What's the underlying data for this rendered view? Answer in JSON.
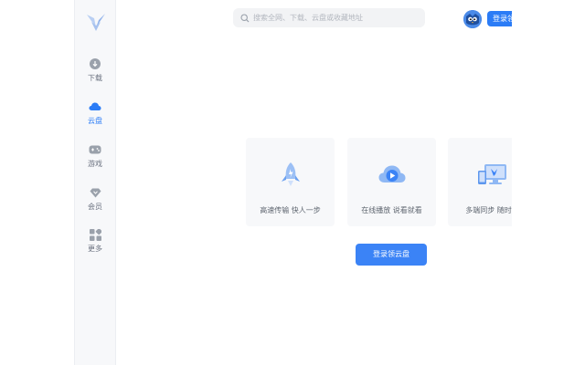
{
  "sidebar": {
    "items": [
      {
        "label": "下载",
        "icon": "download-icon"
      },
      {
        "label": "云盘",
        "icon": "cloud-icon"
      },
      {
        "label": "游戏",
        "icon": "gamepad-icon"
      },
      {
        "label": "会员",
        "icon": "diamond-icon"
      },
      {
        "label": "更多",
        "icon": "grid-icon"
      }
    ],
    "active_index": 1
  },
  "header": {
    "search_placeholder": "搜索全网、下载、云盘或收藏地址",
    "login_label": "登录领"
  },
  "main": {
    "features": [
      {
        "caption": "高速传输 快人一步",
        "icon": "rocket-icon"
      },
      {
        "caption": "在线播放 说看就看",
        "icon": "play-cloud-icon"
      },
      {
        "caption": "多端同步 随时访",
        "icon": "devices-icon"
      }
    ],
    "cta_label": "登录领云盘"
  },
  "colors": {
    "accent": "#2b7cf6",
    "sidebar_bg": "#f7f8fa",
    "card_bg": "#f7f8fa"
  }
}
